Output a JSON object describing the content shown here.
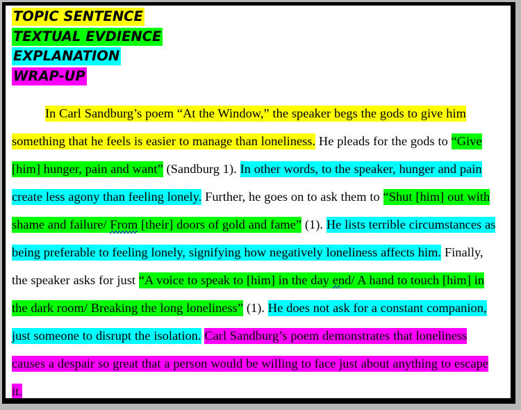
{
  "document": {
    "page_background": "#ffffff",
    "border_color": "#000000"
  },
  "colors": {
    "topic_sentence": "#ffff00",
    "textual_evidence": "#00ff00",
    "explanation": "#00ffff",
    "wrap_up": "#ff00ff",
    "text": "#000000",
    "spellcheck_underline": "#2233cc"
  },
  "legend": {
    "items": [
      {
        "label": "TOPIC SENTENCE",
        "color_key": "topic_sentence"
      },
      {
        "label": "TEXTUAL EVDIENCE",
        "color_key": "textual_evidence"
      },
      {
        "label": "EXPLANATION",
        "color_key": "explanation"
      },
      {
        "label": "WRAP-UP",
        "color_key": "wrap_up"
      }
    ]
  },
  "essay": {
    "segments": [
      {
        "highlight": "topic_sentence",
        "text": "In Carl Sandburg’s poem “At the Window,” the speaker begs the gods to give him something that he feels is easier to manage than loneliness."
      },
      {
        "highlight": "none",
        "text": " He pleads for the gods to "
      },
      {
        "highlight": "textual_evidence",
        "text": "“Give [him] hunger, pain and want”"
      },
      {
        "highlight": "none",
        "text": " (Sandburg 1). "
      },
      {
        "highlight": "explanation",
        "text": "In other words, to the speaker, hunger and pain create less agony than feeling lonely."
      },
      {
        "highlight": "none",
        "text": " Further, he goes on to ask them to "
      },
      {
        "highlight": "textual_evidence",
        "text": "“Shut [him] out with shame and failure/ From [their] doors of gold and fame”",
        "squiggle_word": "From"
      },
      {
        "highlight": "none",
        "text": " (1). "
      },
      {
        "highlight": "explanation",
        "text": "He lists terrible circumstances as being preferable to feeling lonely, signifying how negatively loneliness affects him."
      },
      {
        "highlight": "none",
        "text": " Finally, the speaker asks for just "
      },
      {
        "highlight": "textual_evidence",
        "text": "“A voice to speak to [him] in the day end/ A hand to touch [him] in the dark room/ Breaking the long loneliness”",
        "squiggle_after": "end"
      },
      {
        "highlight": "none",
        "text": " (1). "
      },
      {
        "highlight": "explanation",
        "text": "He does not ask for a constant companion, just someone to disrupt the isolation."
      },
      {
        "highlight": "none",
        "text": " "
      },
      {
        "highlight": "wrap_up",
        "text": "Carl Sandburg’s poem demonstrates that loneliness causes a despair so great that a person would be willing to face just about anything to escape it."
      }
    ]
  }
}
